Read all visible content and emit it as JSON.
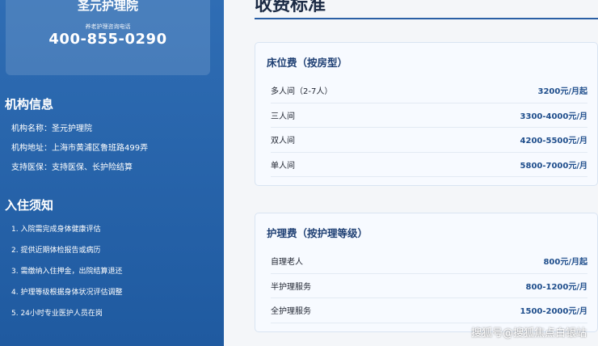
{
  "sidebar": {
    "card": {
      "title": "圣元护理院",
      "subtitle": "养老护理咨询电话",
      "phone": "400-855-0290"
    },
    "info": {
      "heading": "机构信息",
      "items": [
        "机构名称：圣元护理院",
        "机构地址：上海市黄浦区鲁班路499弄",
        "支持医保：支持医保、长护险结算"
      ]
    },
    "notice": {
      "heading": "入住须知",
      "items": [
        "1. 入院需完成身体健康评估",
        "2. 提供近期体检报告或病历",
        "3. 需缴纳入住押金，出院结算退还",
        "4. 护理等级根据身体状况评估调整",
        "5. 24小时专业医护人员在岗"
      ]
    }
  },
  "main": {
    "title": "收费标准",
    "bed_fee": {
      "heading": "床位费（按房型）",
      "rows": [
        {
          "name": "多人间（2-7人）",
          "price": "3200元/月起"
        },
        {
          "name": "三人间",
          "price": "3300-4000元/月"
        },
        {
          "name": "双人间",
          "price": "4200-5500元/月"
        },
        {
          "name": "单人间",
          "price": "5800-7000元/月"
        }
      ]
    },
    "care_fee": {
      "heading": "护理费（按护理等级）",
      "rows": [
        {
          "name": "自理老人",
          "price": "800元/月起"
        },
        {
          "name": "半护理服务",
          "price": "800-1200元/月"
        },
        {
          "name": "全护理服务",
          "price": "1500-2000元/月"
        }
      ]
    }
  },
  "watermark": "搜狐号@搜狐焦点白银站",
  "colors": {
    "sidebar": "#2f6db4",
    "accent": "#1f4e8c",
    "rule": "#2a5fa5"
  }
}
